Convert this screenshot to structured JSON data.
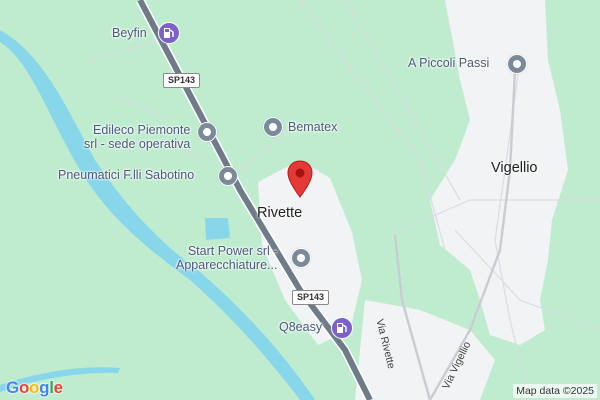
{
  "map": {
    "brand": [
      "G",
      "o",
      "o",
      "g",
      "l",
      "e"
    ],
    "brand_colors": [
      "#4285f4",
      "#ea4335",
      "#fbbc05",
      "#4285f4",
      "#34a853",
      "#ea4335"
    ],
    "attribution": "Map data ©2025",
    "road_shield": "SP143",
    "colors": {
      "land": "#bfeccf",
      "urban": "#f1f3f4",
      "river": "#88d6ea",
      "motorway": "#6f7b88",
      "marker": "#e53935",
      "poi": "#7a8a99",
      "fuel": "#7b61c8"
    },
    "places": {
      "rivette": "Rivette",
      "vigellio": "Vigellio"
    },
    "pois": {
      "beyfin": "Beyfin",
      "edileco_line1": "Edileco Piemonte",
      "edileco_line2": "srl - sede operativa",
      "bematex": "Bematex",
      "pneumatici": "Pneumatici F.lli Sabotino",
      "startpower_line1": "Start Power srl -",
      "startpower_line2": "Apparecchiature...",
      "q8easy": "Q8easy",
      "piccoli_passi": "A Piccoli Passi"
    },
    "streets": {
      "via_rivette": "Via Rivette",
      "via_vigellio": "Via Vigellio"
    },
    "icons": {
      "poi": "poi-pin-icon",
      "fuel": "fuel-station-icon",
      "marker": "location-marker-icon"
    }
  }
}
